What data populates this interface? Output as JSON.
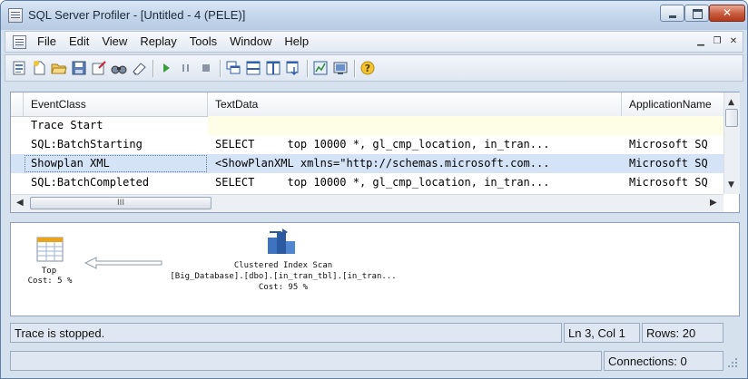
{
  "window": {
    "title": "SQL Server Profiler - [Untitled - 4 (PELE)]"
  },
  "menu": [
    "File",
    "Edit",
    "View",
    "Replay",
    "Tools",
    "Window",
    "Help"
  ],
  "toolbar": {
    "icons": [
      "new-trace-icon",
      "new-template-icon",
      "open-icon",
      "save-icon",
      "properties-icon",
      "find-icon",
      "clear-icon",
      "run-icon",
      "pause-icon",
      "stop-icon",
      "cascade-icon",
      "tile-horizontal-icon",
      "tile-vertical-icon",
      "autoscroll-icon",
      "perfmon-icon",
      "activity-monitor-icon",
      "help-icon"
    ]
  },
  "grid": {
    "columns": [
      "EventClass",
      "TextData",
      "ApplicationName"
    ],
    "rows": [
      {
        "event": "Trace Start",
        "text": "",
        "app": ""
      },
      {
        "event": "SQL:BatchStarting",
        "text": "SELECT     top 10000 *, gl_cmp_location, in_tran...",
        "app": "Microsoft SQ"
      },
      {
        "event": "Showplan XML",
        "text": "<ShowPlanXML xmlns=\"http://schemas.microsoft.com...",
        "app": "Microsoft SQ"
      },
      {
        "event": "SQL:BatchCompleted",
        "text": "SELECT     top 10000 *, gl_cmp_location, in_tran...",
        "app": "Microsoft SQ"
      }
    ],
    "selected_row": 2,
    "hscroll_grip": "III"
  },
  "plan": {
    "top_label": "Top",
    "top_cost": "Cost: 5 %",
    "scan_label": "Clustered Index Scan",
    "scan_object": "[Big_Database].[dbo].[in_tran_tbl].[in_tran...",
    "scan_cost": "Cost: 95 %"
  },
  "status": {
    "message": "Trace is stopped.",
    "position": "Ln 3, Col 1",
    "rows": "Rows: 20",
    "connections": "Connections: 0"
  },
  "colors": {
    "selection": "#d4e4f6",
    "trace_start_row": "#fefde6",
    "close_button": "#c75b3d"
  }
}
